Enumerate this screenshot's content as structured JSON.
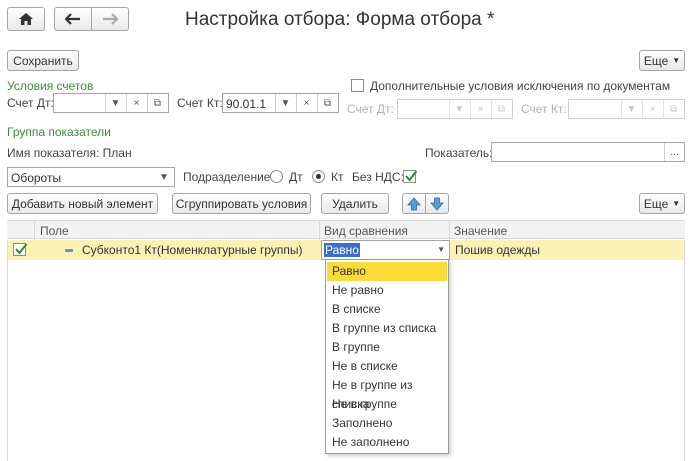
{
  "window": {
    "title": "Настройка отбора: Форма отбора *",
    "home_icon": "home-icon",
    "back_icon": "arrow-left-icon",
    "forward_icon": "arrow-right-icon"
  },
  "toolbar": {
    "save_label": "Сохранить",
    "more_label": "Еще"
  },
  "account_conditions": {
    "header": "Условия счетов",
    "debit_label": "Счет Дт:",
    "debit_value": "",
    "credit_label": "Счет Кт:",
    "credit_value": "90.01.1"
  },
  "extra_conditions": {
    "checkbox_label": "Дополнительные условия исключения по документам",
    "checked": false,
    "debit_label": "Счет Дт:",
    "credit_label": "Счет Кт:"
  },
  "indicators": {
    "group_header": "Группа показатели",
    "name_label": "Имя показателя: План",
    "indicator_label": "Показатель:",
    "indicator_value": "",
    "mode_value": "Обороты",
    "division_label": "Подразделение:",
    "radio_dt": "Дт",
    "radio_kt": "Кт",
    "selected_radio": "Кт",
    "no_vat_label": "Без НДС:",
    "no_vat_checked": true
  },
  "table_toolbar": {
    "add_label": "Добавить новый элемент",
    "group_label": "Сгруппировать условия",
    "delete_label": "Удалить",
    "up_icon": "arrow-up-icon",
    "down_icon": "arrow-down-icon",
    "more_label": "Еще"
  },
  "table": {
    "columns": [
      "Поле",
      "Вид сравнения",
      "Значение"
    ],
    "rows": [
      {
        "checked": true,
        "field": "Субконто1 Кт(Номенклатурные группы)",
        "comparison": "Равно",
        "value": "Пошив одежды"
      }
    ]
  },
  "comparison_dropdown": {
    "options": [
      "Равно",
      "Не равно",
      "В списке",
      "В группе из списка",
      "В группе",
      "Не в списке",
      "Не в группе из списка",
      "Не в группе",
      "Заполнено",
      "Не заполнено"
    ],
    "highlighted": "Равно"
  },
  "colors": {
    "accent_green": "#3c8d3a",
    "row_highlight": "#fbf0b6",
    "option_highlight": "#fbdb3a"
  }
}
